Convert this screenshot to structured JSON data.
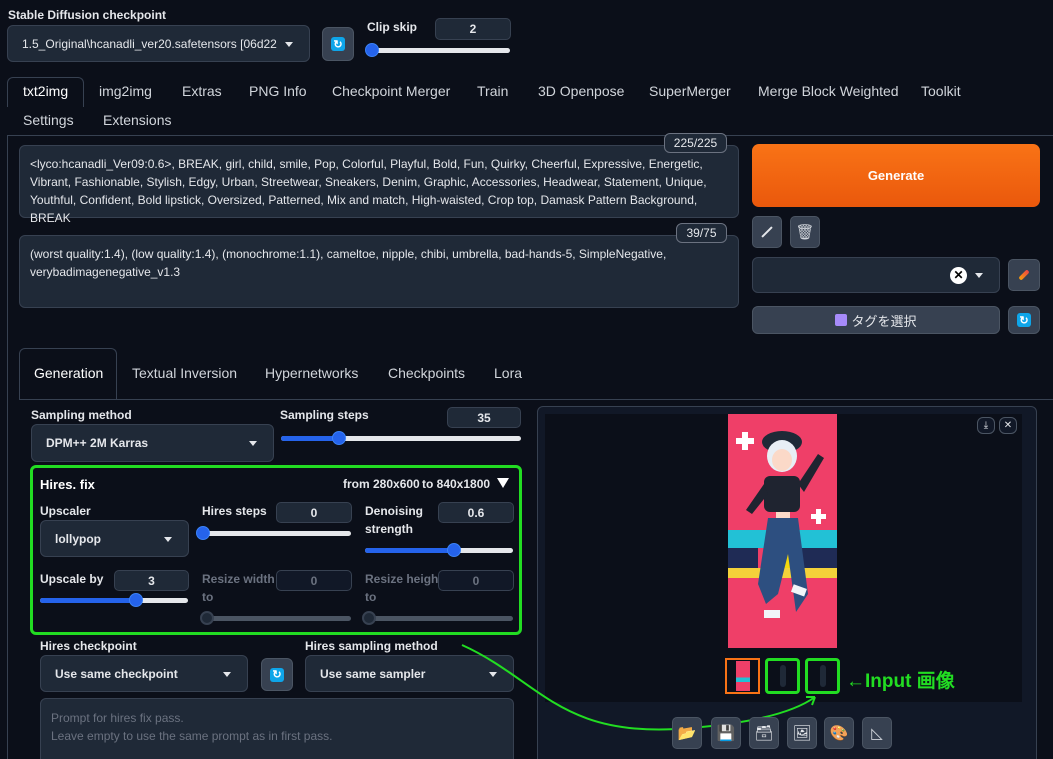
{
  "checkpoint": {
    "label": "Stable Diffusion checkpoint",
    "value": "1.5_Original\\hcanadli_ver20.safetensors [06d22"
  },
  "clip_skip": {
    "label": "Clip skip",
    "value": "2",
    "fraction": 0.0
  },
  "main_tabs": [
    "txt2img",
    "img2img",
    "Extras",
    "PNG Info",
    "Checkpoint Merger",
    "Train",
    "3D Openpose",
    "SuperMerger",
    "Merge Block Weighted",
    "Toolkit",
    "Settings",
    "Extensions"
  ],
  "prompt": {
    "counter": "225/225",
    "text": "<lyco:hcanadli_Ver09:0.6>, BREAK, girl, child, smile, Pop, Colorful, Playful, Bold, Fun, Quirky, Cheerful, Expressive, Energetic, Vibrant, Fashionable, Stylish, Edgy, Urban, Streetwear, Sneakers, Denim, Graphic, Accessories, Headwear, Statement, Unique, Youthful, Confident, Bold lipstick, Oversized, Patterned, Mix and match, High-waisted, Crop top, Damask Pattern Background, BREAK"
  },
  "negative_prompt": {
    "counter": "39/75",
    "text": "(worst quality:1.4), (low quality:1.4), (monochrome:1.1), cameltoe, nipple, chibi, umbrella, bad-hands-5, SimpleNegative, verybadimagenegative_v1.3"
  },
  "generate_label": "Generate",
  "tag_select_label": "タグを選択",
  "sub_tabs": [
    "Generation",
    "Textual Inversion",
    "Hypernetworks",
    "Checkpoints",
    "Lora"
  ],
  "sampling": {
    "method_label": "Sampling method",
    "method_value": "DPM++ 2M Karras",
    "steps_label": "Sampling steps",
    "steps_value": "35",
    "steps_fraction": 0.24
  },
  "hires": {
    "title": "Hires. fix",
    "from_label": "from 280x600",
    "to_label": "to 840x1800",
    "upscaler_label": "Upscaler",
    "upscaler_value": "lollypop",
    "steps_label": "Hires steps",
    "steps_value": "0",
    "steps_fraction": 0.0,
    "denoise_label_1": "Denoising",
    "denoise_label_2": "strength",
    "denoise_value": "0.6",
    "denoise_fraction": 0.6,
    "upscale_by_label": "Upscale by",
    "upscale_by_value": "3",
    "upscale_by_fraction": 0.65,
    "resize_w_label_1": "Resize width",
    "resize_w_label_2": "to",
    "resize_w_value": "0",
    "resize_h_label_1": "Resize height",
    "resize_h_label_2": "to",
    "resize_h_value": "0",
    "checkpoint_label": "Hires checkpoint",
    "checkpoint_value": "Use same checkpoint",
    "sampler_label": "Hires sampling method",
    "sampler_value": "Use same sampler",
    "prompt_placeholder_1": "Prompt for hires fix pass.",
    "prompt_placeholder_2": "Leave empty to use the same prompt as in first pass."
  },
  "annotation": {
    "text": "←Input 画像",
    "color": "#22dd22"
  },
  "colors": {
    "accent": "#f97316",
    "highlight": "#22dd22",
    "slider": "#2563eb"
  }
}
